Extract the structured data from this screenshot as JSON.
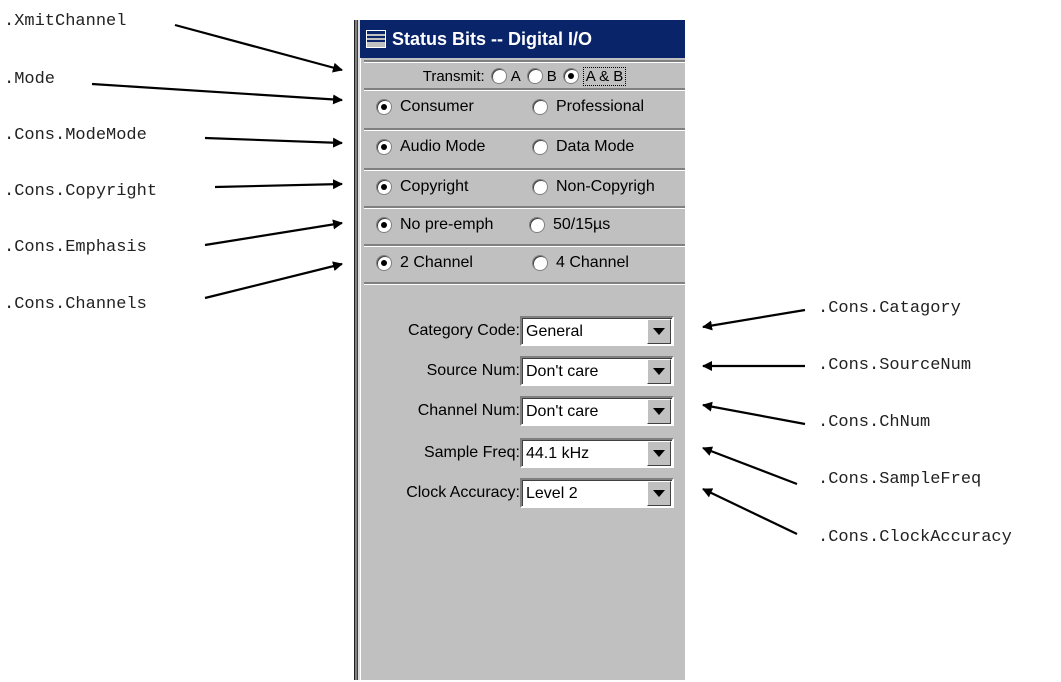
{
  "annotations": {
    "xmit_channel": ".XmitChannel",
    "mode": ".Mode",
    "cons_mode_mode": ".Cons.ModeMode",
    "cons_copyright": ".Cons.Copyright",
    "cons_emphasis": ".Cons.Emphasis",
    "cons_channels": ".Cons.Channels",
    "cons_category": ".Cons.Catagory",
    "cons_source_num": ".Cons.SourceNum",
    "cons_ch_num": ".Cons.ChNum",
    "cons_sample_freq": ".Cons.SampleFreq",
    "cons_clock_accuracy": ".Cons.ClockAccuracy"
  },
  "window": {
    "title": "Status Bits -- Digital I/O"
  },
  "transmit": {
    "label": "Transmit:",
    "options": [
      "A",
      "B",
      "A & B"
    ],
    "selected": "A & B"
  },
  "radio_rows": [
    {
      "left": "Consumer",
      "right": "Professional",
      "selected": "left"
    },
    {
      "left": "Audio Mode",
      "right": "Data Mode",
      "selected": "left"
    },
    {
      "left": "Copyright",
      "right": "Non-Copyrigh",
      "selected": "left"
    },
    {
      "left": "No pre-emph",
      "right": "50/15µs",
      "selected": "left"
    },
    {
      "left": "2 Channel",
      "right": "4 Channel",
      "selected": "left"
    }
  ],
  "fields": {
    "category": {
      "label": "Category Code:",
      "value": "General"
    },
    "source_num": {
      "label": "Source Num:",
      "value": "Don't care"
    },
    "channel_num": {
      "label": "Channel Num:",
      "value": "Don't care"
    },
    "sample_freq": {
      "label": "Sample Freq:",
      "value": "44.1 kHz"
    },
    "clock_accuracy": {
      "label": "Clock Accuracy:",
      "value": "Level 2"
    }
  },
  "colors": {
    "titlebar": "#0a246a",
    "face": "#c0c0c0"
  }
}
